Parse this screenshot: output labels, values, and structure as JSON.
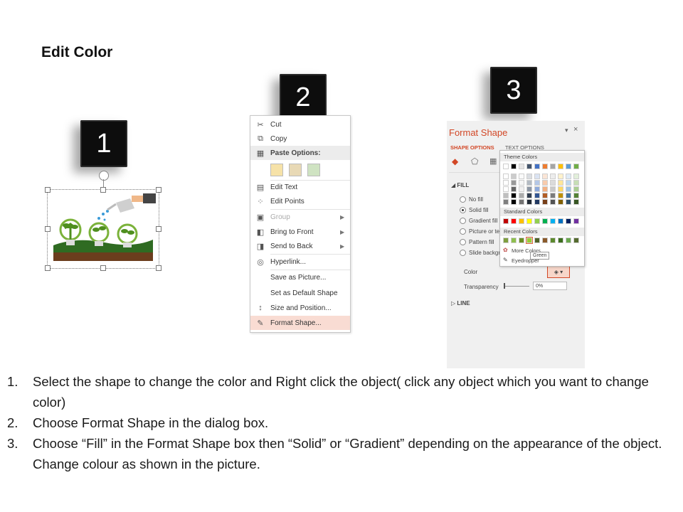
{
  "title": "Edit Color",
  "steps": [
    "1",
    "2",
    "3"
  ],
  "context_menu": {
    "items": [
      {
        "icon": "scissors-icon",
        "glyph": "✂",
        "label": "Cut"
      },
      {
        "icon": "copy-icon",
        "glyph": "⧉",
        "label": "Copy"
      },
      {
        "icon": "paste-icon",
        "glyph": "📋",
        "label": "Paste Options:"
      },
      {
        "icon": "edit-text-icon",
        "glyph": "▤",
        "label": "Edit Text"
      },
      {
        "icon": "edit-points-icon",
        "glyph": "⁘",
        "label": "Edit Points"
      },
      {
        "icon": "group-icon",
        "glyph": "▣",
        "label": "Group"
      },
      {
        "icon": "bring-front-icon",
        "glyph": "◧",
        "label": "Bring to Front"
      },
      {
        "icon": "send-back-icon",
        "glyph": "◨",
        "label": "Send to Back"
      },
      {
        "icon": "hyperlink-icon",
        "glyph": "🌐",
        "label": "Hyperlink..."
      },
      {
        "icon": "",
        "glyph": "",
        "label": "Save as Picture..."
      },
      {
        "icon": "",
        "glyph": "",
        "label": "Set as Default Shape"
      },
      {
        "icon": "size-position-icon",
        "glyph": "↕",
        "label": "Size and Position..."
      },
      {
        "icon": "format-shape-icon",
        "glyph": "✎",
        "label": "Format Shape..."
      }
    ]
  },
  "format_pane": {
    "title": "Format Shape",
    "tab_shape": "SHAPE OPTIONS",
    "tab_text": "TEXT OPTIONS",
    "section_fill": "FILL",
    "fill_options": [
      "No fill",
      "Solid fill",
      "Gradient fill",
      "Picture or te",
      "Pattern fill",
      "Slide backgr"
    ],
    "color_label": "Color",
    "transparency_label": "Transparency",
    "transparency_value": "0%",
    "section_line": "LINE",
    "picker": {
      "theme_colors": "Theme Colors",
      "standard_colors": "Standard Colors",
      "recent_colors": "Recent Colors",
      "more_colors": "More Colors...",
      "eyedropper": "Eyedropper",
      "tooltip": "Green"
    },
    "theme_row": [
      "#ffffff",
      "#000000",
      "#e7e6e6",
      "#44546a",
      "#4472c4",
      "#ed7d31",
      "#a5a5a5",
      "#ffc000",
      "#5b9bd5",
      "#70ad47"
    ],
    "standard_row": [
      "#c00000",
      "#ff0000",
      "#ffc000",
      "#ffff00",
      "#92d050",
      "#00b050",
      "#00b0f0",
      "#0070c0",
      "#002060",
      "#7030a0"
    ],
    "recent_row": [
      "#7f9f3f",
      "#8fbf4f",
      "#6b8e23",
      "#9acd32",
      "#4f6228",
      "#8b5a2b",
      "#5c8a2e",
      "#3c6e1e",
      "#6aa84f",
      "#556b2f"
    ],
    "accent": "#d24726"
  },
  "instructions": [
    {
      "num": "1.",
      "text": "Select the shape to change the color and Right click the object( click any object which you want to change color)"
    },
    {
      "num": "2.",
      "text": "Choose Format Shape in the dialog box."
    },
    {
      "num": "3.",
      "text": "Choose “Fill” in the Format Shape box then “Solid” or “Gradient” depending on the appearance of the object. Change colour as shown in the picture."
    }
  ]
}
